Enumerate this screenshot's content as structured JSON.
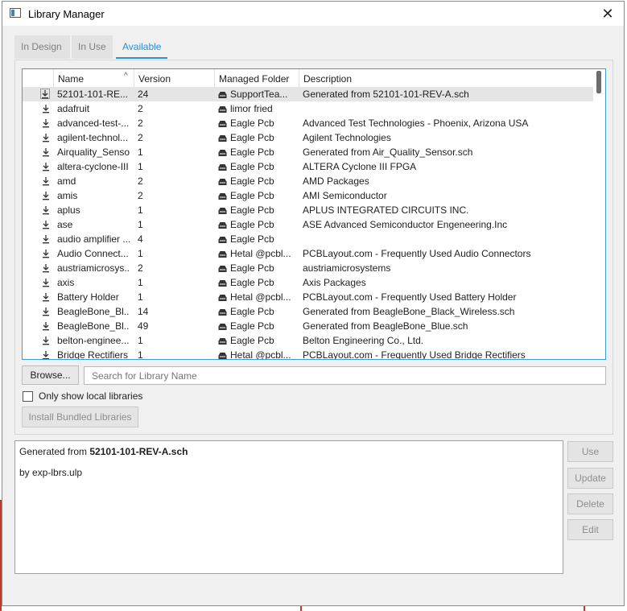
{
  "window": {
    "title": "Library Manager",
    "close_glyph": "✕"
  },
  "tabs": [
    {
      "label": "In Design",
      "active": false
    },
    {
      "label": "In Use",
      "active": false
    },
    {
      "label": "Available",
      "active": true
    }
  ],
  "table": {
    "sort_indicator": "^",
    "columns": [
      "Name",
      "Version",
      "Managed Folder",
      "Description"
    ],
    "rows": [
      {
        "name": "52101-101-RE...",
        "version": "24",
        "folder": "SupportTea...",
        "description": "Generated from 52101-101-REV-A.sch",
        "selected": true
      },
      {
        "name": "adafruit",
        "version": "2",
        "folder": "limor fried",
        "description": ""
      },
      {
        "name": "advanced-test-...",
        "version": "2",
        "folder": "Eagle Pcb",
        "description": "Advanced Test Technologies - Phoenix, Arizona USA"
      },
      {
        "name": "agilent-technol...",
        "version": "2",
        "folder": "Eagle Pcb",
        "description": "Agilent Technologies"
      },
      {
        "name": "Airquality_Sensor",
        "version": "1",
        "folder": "Eagle Pcb",
        "description": "Generated from Air_Quality_Sensor.sch"
      },
      {
        "name": "altera-cyclone-III",
        "version": "1",
        "folder": "Eagle Pcb",
        "description": "ALTERA Cyclone III FPGA"
      },
      {
        "name": "amd",
        "version": "2",
        "folder": "Eagle Pcb",
        "description": "AMD Packages"
      },
      {
        "name": "amis",
        "version": "2",
        "folder": "Eagle Pcb",
        "description": "AMI Semiconductor"
      },
      {
        "name": "aplus",
        "version": "1",
        "folder": "Eagle Pcb",
        "description": "APLUS INTEGRATED CIRCUITS INC."
      },
      {
        "name": "ase",
        "version": "1",
        "folder": "Eagle Pcb",
        "description": "ASE Advanced Semiconductor Engeneering.Inc"
      },
      {
        "name": "audio amplifier ...",
        "version": "4",
        "folder": "Eagle Pcb",
        "description": ""
      },
      {
        "name": "Audio Connect...",
        "version": "1",
        "folder": "Hetal @pcbl...",
        "description": "PCBLayout.com - Frequently Used Audio Connectors"
      },
      {
        "name": "austriamicrosys...",
        "version": "2",
        "folder": "Eagle Pcb",
        "description": "austriamicrosystems"
      },
      {
        "name": "axis",
        "version": "1",
        "folder": "Eagle Pcb",
        "description": "Axis Packages"
      },
      {
        "name": "Battery Holder",
        "version": "1",
        "folder": "Hetal @pcbl...",
        "description": "PCBLayout.com - Frequently Used Battery Holder"
      },
      {
        "name": "BeagleBone_Bl...",
        "version": "14",
        "folder": "Eagle Pcb",
        "description": "Generated from BeagleBone_Black_Wireless.sch"
      },
      {
        "name": "BeagleBone_Bl...",
        "version": "49",
        "folder": "Eagle Pcb",
        "description": "Generated from BeagleBone_Blue.sch"
      },
      {
        "name": "belton-enginee...",
        "version": "1",
        "folder": "Eagle Pcb",
        "description": "Belton Engineering Co., Ltd."
      },
      {
        "name": "Bridge Rectifiers",
        "version": "1",
        "folder": "Hetal @pcbl...",
        "description": "PCBLayout.com - Frequently Used Bridge Rectifiers"
      }
    ]
  },
  "controls": {
    "browse_label": "Browse...",
    "search_placeholder": "Search for Library Name",
    "only_local_label": "Only show local libraries",
    "only_local_checked": false,
    "install_bundled_label": "Install Bundled Libraries"
  },
  "details": {
    "prefix": "Generated from ",
    "filename": "52101-101-REV-A.sch",
    "author_line": "by exp-lbrs.ulp"
  },
  "actions": {
    "use": "Use",
    "update": "Update",
    "delete": "Delete",
    "edit": "Edit"
  },
  "colors": {
    "accent": "#2e8ed3",
    "table_border": "#3a9bd5",
    "selected_row": "#e5e5e5"
  }
}
